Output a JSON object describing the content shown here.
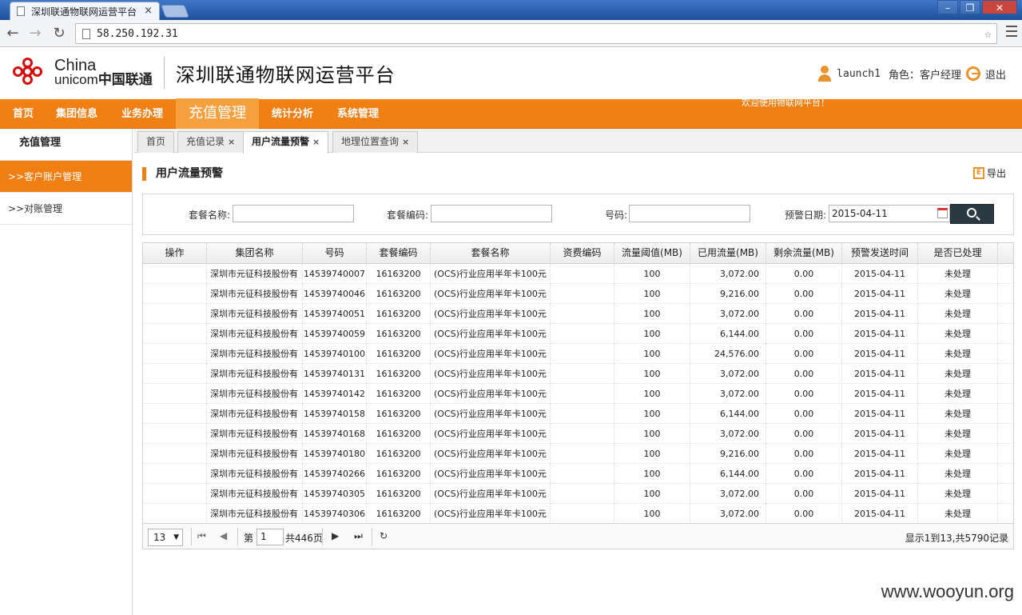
{
  "browser": {
    "tab_title": "深圳联通物联网运营平台",
    "tab_close": "×",
    "url": "58.250.192.31"
  },
  "header": {
    "logo_line1": "China",
    "logo_line2a": "unicom",
    "logo_line2b": "中国联通",
    "site_title": "深圳联通物联网运营平台",
    "username": "launch1",
    "role": "角色：客户经理",
    "logout": "退出"
  },
  "mainnav": {
    "items": [
      "首页",
      "集团信息",
      "业务办理",
      "充值管理",
      "统计分析",
      "系统管理"
    ],
    "marquee": "欢迎使用物联网平台！"
  },
  "sidebar": {
    "title": "充值管理",
    "items": [
      ">>客户账户管理",
      ">>对账管理"
    ]
  },
  "page_tabs": [
    "首页",
    "充值记录",
    "用户流量预警",
    "地理位置查询"
  ],
  "page_tab_close": "×",
  "section": {
    "title": "用户流量预警",
    "export": "导出",
    "export_icon_letter": "E"
  },
  "filter": {
    "plan_name_label": "套餐名称:",
    "plan_code_label": "套餐编码:",
    "number_label": "号码:",
    "date_label": "预警日期:",
    "date_value": "2015-04-11"
  },
  "table": {
    "headers": [
      "操作",
      "集团名称",
      "号码",
      "套餐编码",
      "套餐名称",
      "资费编码",
      "流量阈值(MB)",
      "已用流量(MB)",
      "剩余流量(MB)",
      "预警发送时间",
      "是否已处理"
    ],
    "rows": [
      [
        "",
        "深圳市元征科技股份有",
        "14539740007",
        "16163200",
        "(OCS)行业应用半年卡100元",
        "",
        "100",
        "3,072.00",
        "0.00",
        "2015-04-11",
        "未处理"
      ],
      [
        "",
        "深圳市元征科技股份有",
        "14539740046",
        "16163200",
        "(OCS)行业应用半年卡100元",
        "",
        "100",
        "9,216.00",
        "0.00",
        "2015-04-11",
        "未处理"
      ],
      [
        "",
        "深圳市元征科技股份有",
        "14539740051",
        "16163200",
        "(OCS)行业应用半年卡100元",
        "",
        "100",
        "3,072.00",
        "0.00",
        "2015-04-11",
        "未处理"
      ],
      [
        "",
        "深圳市元征科技股份有",
        "14539740059",
        "16163200",
        "(OCS)行业应用半年卡100元",
        "",
        "100",
        "6,144.00",
        "0.00",
        "2015-04-11",
        "未处理"
      ],
      [
        "",
        "深圳市元征科技股份有",
        "14539740100",
        "16163200",
        "(OCS)行业应用半年卡100元",
        "",
        "100",
        "24,576.00",
        "0.00",
        "2015-04-11",
        "未处理"
      ],
      [
        "",
        "深圳市元征科技股份有",
        "14539740131",
        "16163200",
        "(OCS)行业应用半年卡100元",
        "",
        "100",
        "3,072.00",
        "0.00",
        "2015-04-11",
        "未处理"
      ],
      [
        "",
        "深圳市元征科技股份有",
        "14539740142",
        "16163200",
        "(OCS)行业应用半年卡100元",
        "",
        "100",
        "3,072.00",
        "0.00",
        "2015-04-11",
        "未处理"
      ],
      [
        "",
        "深圳市元征科技股份有",
        "14539740158",
        "16163200",
        "(OCS)行业应用半年卡100元",
        "",
        "100",
        "6,144.00",
        "0.00",
        "2015-04-11",
        "未处理"
      ],
      [
        "",
        "深圳市元征科技股份有",
        "14539740168",
        "16163200",
        "(OCS)行业应用半年卡100元",
        "",
        "100",
        "3,072.00",
        "0.00",
        "2015-04-11",
        "未处理"
      ],
      [
        "",
        "深圳市元征科技股份有",
        "14539740180",
        "16163200",
        "(OCS)行业应用半年卡100元",
        "",
        "100",
        "9,216.00",
        "0.00",
        "2015-04-11",
        "未处理"
      ],
      [
        "",
        "深圳市元征科技股份有",
        "14539740266",
        "16163200",
        "(OCS)行业应用半年卡100元",
        "",
        "100",
        "6,144.00",
        "0.00",
        "2015-04-11",
        "未处理"
      ],
      [
        "",
        "深圳市元征科技股份有",
        "14539740305",
        "16163200",
        "(OCS)行业应用半年卡100元",
        "",
        "100",
        "3,072.00",
        "0.00",
        "2015-04-11",
        "未处理"
      ],
      [
        "",
        "深圳市元征科技股份有",
        "14539740306",
        "16163200",
        "(OCS)行业应用半年卡100元",
        "",
        "100",
        "3,072.00",
        "0.00",
        "2015-04-11",
        "未处理"
      ]
    ]
  },
  "pager": {
    "page_size": "13",
    "page_prefix": "第",
    "page_value": "1",
    "page_total": "共446页",
    "info": "显示1到13,共5790记录"
  },
  "watermark": "www.wooyun.org",
  "colors": {
    "brand_orange": "#f07f14",
    "active_orange": "#f7a040",
    "logo_red": "#d40c0c"
  }
}
